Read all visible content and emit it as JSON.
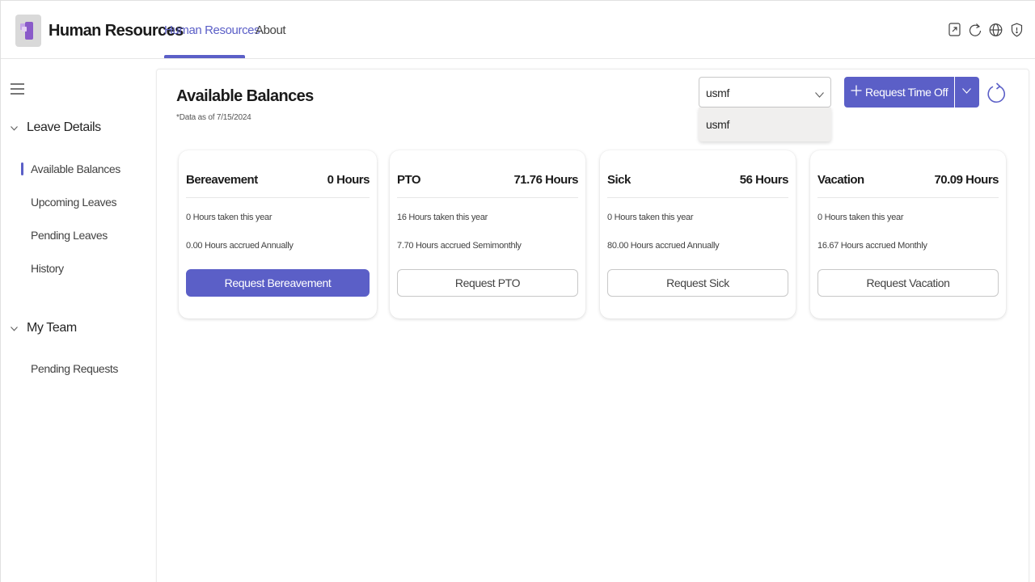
{
  "header": {
    "app_title": "Human Resources",
    "tabs": [
      {
        "label": "Human Resources",
        "active": true
      },
      {
        "label": "About",
        "active": false
      }
    ],
    "icons": [
      "popout-icon",
      "refresh-icon",
      "globe-icon",
      "shield-icon"
    ]
  },
  "sidebar": {
    "groups": [
      {
        "label": "Leave Details",
        "expanded": true,
        "items": [
          {
            "label": "Available Balances",
            "selected": true
          },
          {
            "label": "Upcoming Leaves",
            "selected": false
          },
          {
            "label": "Pending Leaves",
            "selected": false
          },
          {
            "label": "History",
            "selected": false
          }
        ]
      },
      {
        "label": "My Team",
        "expanded": true,
        "items": [
          {
            "label": "Pending Requests",
            "selected": false
          }
        ]
      }
    ]
  },
  "main": {
    "title": "Available Balances",
    "subtitle": "*Data as of 7/15/2024",
    "company_select": {
      "value": "usmf",
      "options": [
        "usmf"
      ]
    },
    "request_button_label": "Request Time Off",
    "cards": [
      {
        "title": "Bereavement",
        "hours": "0 Hours",
        "taken": "0 Hours taken this year",
        "accrued": "0.00 Hours accrued Annually",
        "button": "Request Bereavement",
        "primary": true
      },
      {
        "title": "PTO",
        "hours": "71.76 Hours",
        "taken": "16 Hours taken this year",
        "accrued": "7.70 Hours accrued Semimonthly",
        "button": "Request PTO",
        "primary": false
      },
      {
        "title": "Sick",
        "hours": "56 Hours",
        "taken": "0 Hours taken this year",
        "accrued": "80.00 Hours accrued Annually",
        "button": "Request Sick",
        "primary": false
      },
      {
        "title": "Vacation",
        "hours": "70.09 Hours",
        "taken": "0 Hours taken this year",
        "accrued": "16.67 Hours accrued Monthly",
        "button": "Request Vacation",
        "primary": false
      }
    ]
  },
  "colors": {
    "accent": "#5b5fc7",
    "text": "#242424",
    "border": "#c8c8c8"
  }
}
